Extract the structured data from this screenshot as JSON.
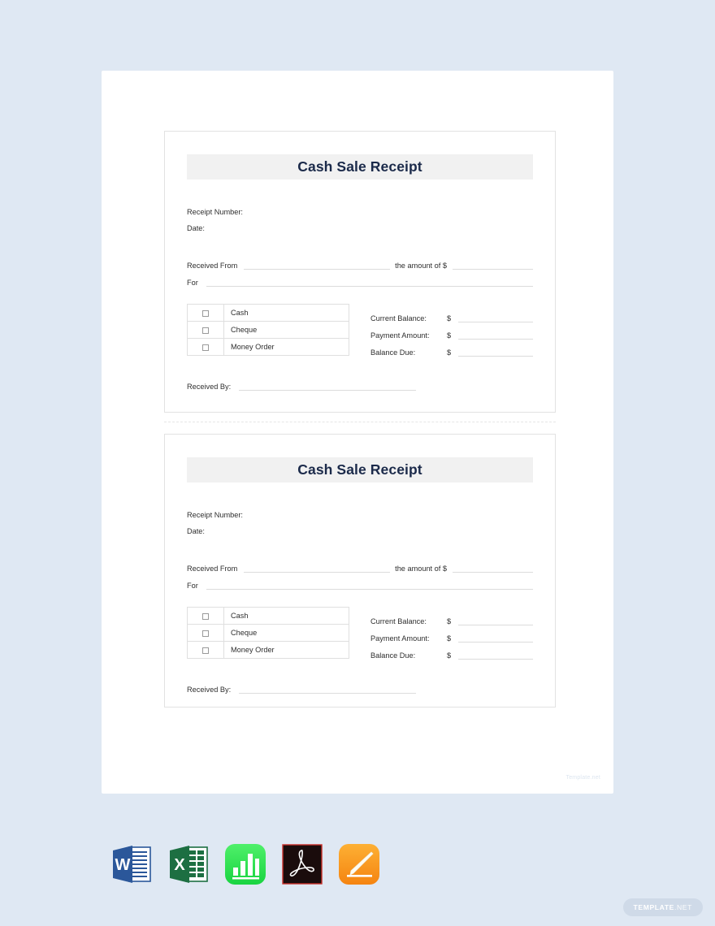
{
  "document": {
    "watermark": "Template.net"
  },
  "receipts": [
    {
      "title": "Cash Sale Receipt",
      "receipt_number_label": "Receipt Number:",
      "date_label": "Date:",
      "received_from_label": "Received From",
      "amount_of_label": "the amount of $",
      "for_label": "For",
      "payment_methods": [
        "Cash",
        "Cheque",
        "Money Order"
      ],
      "balances": [
        {
          "label": "Current Balance:",
          "currency": "$",
          "value": ""
        },
        {
          "label": "Payment Amount:",
          "currency": "$",
          "value": ""
        },
        {
          "label": "Balance Due:",
          "currency": "$",
          "value": ""
        }
      ],
      "received_by_label": "Received By:"
    },
    {
      "title": "Cash Sale Receipt",
      "receipt_number_label": "Receipt Number:",
      "date_label": "Date:",
      "received_from_label": "Received From",
      "amount_of_label": "the amount of $",
      "for_label": "For",
      "payment_methods": [
        "Cash",
        "Cheque",
        "Money Order"
      ],
      "balances": [
        {
          "label": "Current Balance:",
          "currency": "$",
          "value": ""
        },
        {
          "label": "Payment Amount:",
          "currency": "$",
          "value": ""
        },
        {
          "label": "Balance Due:",
          "currency": "$",
          "value": ""
        }
      ],
      "received_by_label": "Received By:"
    }
  ],
  "formats": [
    {
      "name": "word-icon",
      "label": "Word",
      "color": "#2b579a"
    },
    {
      "name": "excel-icon",
      "label": "Excel",
      "color": "#1d6f42"
    },
    {
      "name": "numbers-icon",
      "label": "Numbers",
      "color": "#39e05b"
    },
    {
      "name": "pdf-icon",
      "label": "PDF",
      "color": "#1a0c0c"
    },
    {
      "name": "pages-icon",
      "label": "Pages",
      "color": "#f79a1e"
    }
  ],
  "badge": {
    "primary": "TEMPLATE",
    "secondary": ".NET"
  },
  "colors": {
    "background": "#dfe8f3",
    "page": "#ffffff",
    "title_text": "#1b2a4a",
    "title_band": "#f1f1f1",
    "body_text": "#2e2e2e",
    "rule": "#dcdcdc",
    "border": "#e2e2e2"
  }
}
